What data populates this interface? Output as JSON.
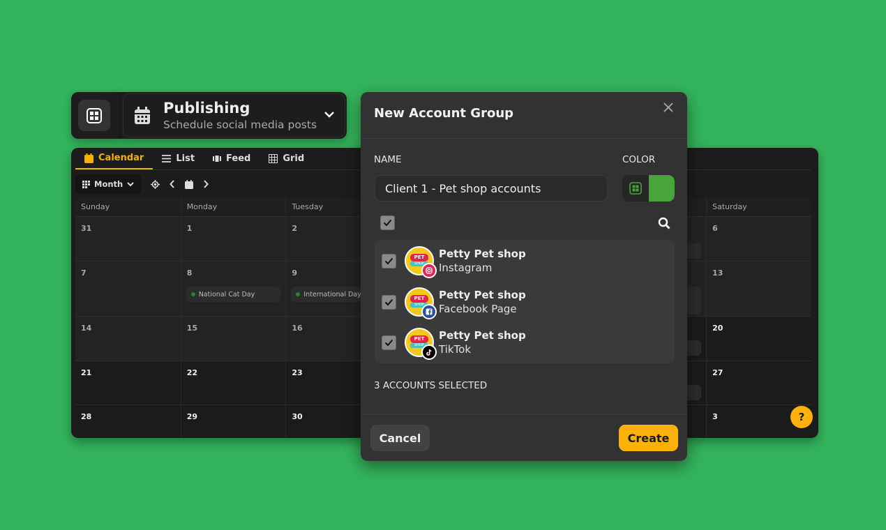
{
  "header": {
    "title": "Publishing",
    "subtitle": "Schedule social media posts"
  },
  "calendar": {
    "tabs": [
      {
        "label": "Calendar",
        "icon": "calendar-icon",
        "active": true
      },
      {
        "label": "List",
        "icon": "list-icon"
      },
      {
        "label": "Feed",
        "icon": "feed-icon"
      },
      {
        "label": "Grid",
        "icon": "grid-icon"
      }
    ],
    "view_label": "Month",
    "weekdays": [
      "Sunday",
      "Monday",
      "Tuesday",
      "",
      "",
      "",
      "Saturday"
    ],
    "weeks": [
      [
        {
          "d": "31"
        },
        {
          "d": "1"
        },
        {
          "d": "2"
        },
        {
          "d": ""
        },
        {
          "d": ""
        },
        {
          "d": "",
          "ev": ""
        },
        {
          "d": "6"
        }
      ],
      [
        {
          "d": "7"
        },
        {
          "d": "8",
          "ev": "National Cat Day"
        },
        {
          "d": "9",
          "ev": "International Day o"
        },
        {
          "d": ""
        },
        {
          "d": ""
        },
        {
          "d": "",
          "ev": ""
        },
        {
          "d": "13"
        }
      ],
      [
        {
          "d": "14"
        },
        {
          "d": "15"
        },
        {
          "d": "16"
        },
        {
          "d": ""
        },
        {
          "d": ""
        },
        {
          "d": "",
          "ev": "",
          "cur": true
        },
        {
          "d": "20",
          "cur": true
        }
      ],
      [
        {
          "d": "21",
          "cur": true
        },
        {
          "d": "22",
          "cur": true
        },
        {
          "d": "23",
          "cur": true
        },
        {
          "d": "",
          "cur": true
        },
        {
          "d": "",
          "cur": true
        },
        {
          "d": "",
          "ev": "",
          "cur": true
        },
        {
          "d": "27",
          "cur": true
        }
      ],
      [
        {
          "d": "28",
          "cur": true
        },
        {
          "d": "29",
          "cur": true
        },
        {
          "d": "30",
          "cur": true
        },
        {
          "d": "",
          "cur": true
        },
        {
          "d": "",
          "cur": true
        },
        {
          "d": "",
          "cur": true
        },
        {
          "d": "3",
          "cur": true
        }
      ]
    ],
    "help_label": "?"
  },
  "modal": {
    "title": "New Account Group",
    "name_label": "NAME",
    "name_value": "Client 1 - Pet shop accounts",
    "color_label": "COLOR",
    "color_value": "#47a53a",
    "accounts": [
      {
        "name": "Petty Pet shop",
        "type": "Instagram",
        "network_icon": "instagram-icon",
        "badge_color": "#e1245a",
        "checked": true
      },
      {
        "name": "Petty Pet shop",
        "type": "Facebook Page",
        "network_icon": "facebook-icon",
        "badge_color": "#2d4fa0",
        "checked": true
      },
      {
        "name": "Petty Pet shop",
        "type": "TikTok",
        "network_icon": "tiktok-icon",
        "badge_color": "#000000",
        "checked": true
      }
    ],
    "avatar_text": {
      "top": "PET",
      "bottom": "SHOP"
    },
    "selected_count": "3 ACCOUNTS SELECTED",
    "cancel_label": "Cancel",
    "create_label": "Create"
  },
  "colors": {
    "background": "#33b45c",
    "accent": "#fdb10a",
    "event_dot": "#1f8a2a"
  }
}
